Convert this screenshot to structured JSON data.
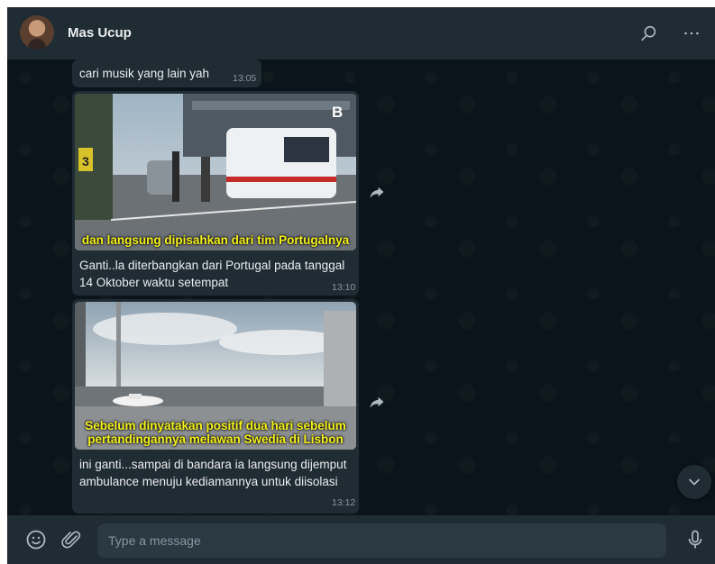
{
  "header": {
    "contact_name": "Mas Ucup"
  },
  "messages": [
    {
      "text": "cari musik yang lain yah",
      "time": "13:05"
    },
    {
      "overlay": "dan langsung dipisahkan dari tim Portugalnya",
      "watermark": "B",
      "caption": "Ganti..la diterbangkan dari Portugal pada tanggal 14 Oktober waktu setempat",
      "time": "13:10"
    },
    {
      "overlay": "Sebelum dinyatakan positif dua hari sebelum pertandingannya melawan Swedia di Lisbon",
      "caption": "ini ganti...sampai di bandara ia langsung dijemput ambulance menuju kediamannya untuk diisolasi",
      "time": "13:12"
    }
  ],
  "footer": {
    "placeholder": "Type a message"
  },
  "icons": [
    "search-icon",
    "menu-icon",
    "forward-icon",
    "chevron-down-icon",
    "emoji-icon",
    "attach-icon",
    "mic-icon"
  ],
  "colors": {
    "header_bg": "#202c33",
    "chat_bg": "#0b141a",
    "bubble_bg": "#202c33",
    "input_bg": "#2a3942",
    "overlay_text": "#f4f11b"
  }
}
